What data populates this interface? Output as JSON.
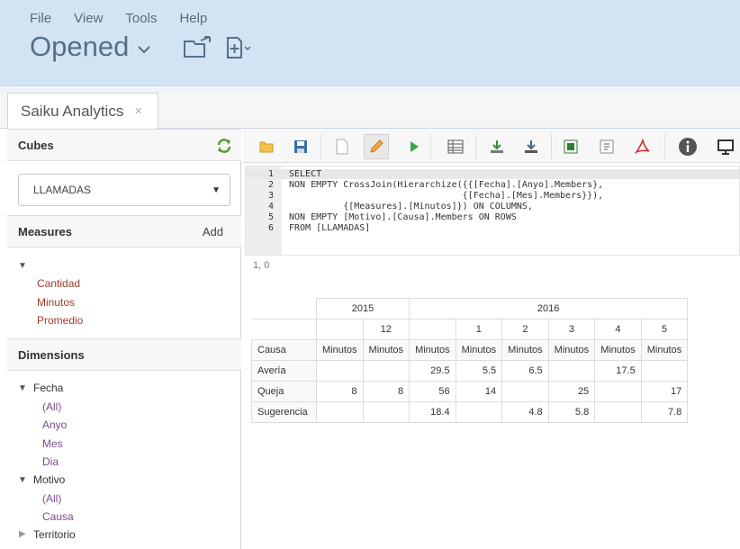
{
  "menu": [
    "File",
    "View",
    "Tools",
    "Help"
  ],
  "opened_label": "Opened",
  "tab": {
    "title": "Saiku Analytics",
    "close": "×"
  },
  "sidebar": {
    "cubes_title": "Cubes",
    "cube_selected": "LLAMADAS",
    "measures_title": "Measures",
    "measures_add": "Add",
    "measures": [
      "Cantidad",
      "Minutos",
      "Promedio"
    ],
    "dimensions_title": "Dimensions",
    "dimensions": [
      {
        "name": "Fecha",
        "children": [
          "(All)",
          "Anyo",
          "Mes",
          "Dia"
        ]
      },
      {
        "name": "Motivo",
        "children": [
          "(All)",
          "Causa"
        ]
      },
      {
        "name": "Territorio",
        "children": []
      }
    ]
  },
  "editor": {
    "lines": [
      {
        "n": "1",
        "code": "SELECT"
      },
      {
        "n": "2",
        "code": "NON EMPTY CrossJoin(Hierarchize({{[Fecha].[Anyo].Members},"
      },
      {
        "n": "3",
        "code": "                                {[Fecha].[Mes].Members}}),"
      },
      {
        "n": "4",
        "code": "          {[Measures].[Minutos]}) ON COLUMNS,"
      },
      {
        "n": "5",
        "code": "NON EMPTY [Motivo].[Causa].Members ON ROWS"
      },
      {
        "n": "6",
        "code": "FROM [LLAMADAS]"
      }
    ],
    "cursor": "1, 0"
  },
  "table": {
    "years": [
      "2015",
      "2016"
    ],
    "months": [
      "12",
      "1",
      "2",
      "3",
      "4",
      "5"
    ],
    "row_header": "Causa",
    "measure": "Minutos",
    "rows": [
      {
        "label": "Avería",
        "values": [
          "",
          "",
          "29.5",
          "5.5",
          "6.5",
          "",
          "17.5",
          ""
        ]
      },
      {
        "label": "Queja",
        "values": [
          "8",
          "8",
          "56",
          "14",
          "",
          "25",
          "",
          "17"
        ]
      },
      {
        "label": "Sugerencia",
        "values": [
          "",
          "",
          "18.4",
          "",
          "4.8",
          "5.8",
          "",
          "7.8"
        ]
      }
    ]
  },
  "colors": {
    "header_bg": "#d2e4f3",
    "measure_text": "#9b3c2c",
    "dimension_child_text": "#7c4a8e"
  }
}
